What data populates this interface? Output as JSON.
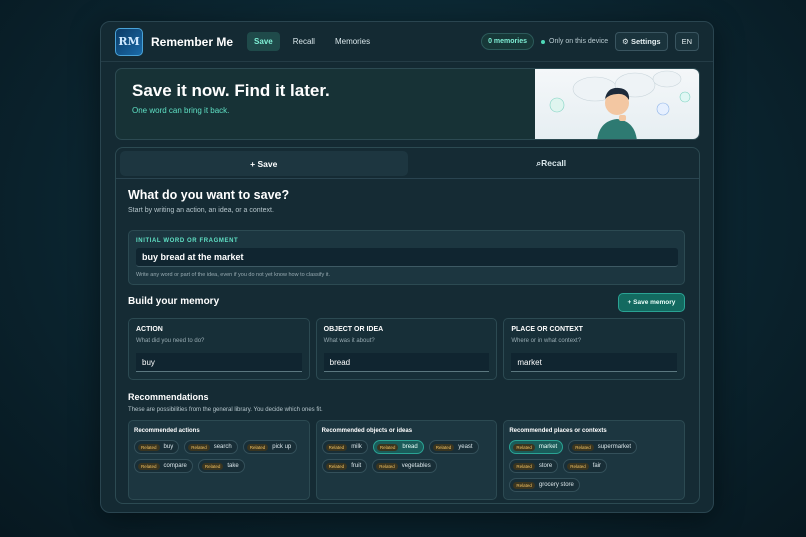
{
  "app": {
    "logo_text": "RM",
    "brand": "Remember Me",
    "nav": [
      "Save",
      "Recall",
      "Memories"
    ],
    "memories_count": "0 memories",
    "device_note": "Only on this device",
    "settings_label": "Settings",
    "lang": "EN"
  },
  "hero": {
    "title": "Save it now. Find it later.",
    "subtitle": "One word can bring it back."
  },
  "tabs": {
    "save": "+ Save",
    "recall": "⌕Recall"
  },
  "save": {
    "title": "What do you want to save?",
    "description": "Start by writing an action, an idea, or a context.",
    "initial_label": "INITIAL WORD OR FRAGMENT",
    "initial_value": "buy bread at the market",
    "initial_help": "Write any word or part of the idea, even if you do not yet know how to classify it."
  },
  "build": {
    "title": "Build your memory",
    "save_button": "+ Save memory",
    "fields": [
      {
        "title": "ACTION",
        "help": "What did you need to do?",
        "value": "buy"
      },
      {
        "title": "OBJECT OR IDEA",
        "help": "What was it about?",
        "value": "bread"
      },
      {
        "title": "PLACE OR CONTEXT",
        "help": "Where or in what context?",
        "value": "market"
      }
    ]
  },
  "recommendations": {
    "title": "Recommendations",
    "description": "These are possibilities from the general library. You decide which ones fit.",
    "tag": "Related",
    "groups": [
      {
        "title": "Recommended actions",
        "chips": [
          "buy",
          "search",
          "pick up",
          "compare",
          "take"
        ]
      },
      {
        "title": "Recommended objects or ideas",
        "chips": [
          "milk",
          "bread",
          "yeast",
          "fruit",
          "vegetables"
        ]
      },
      {
        "title": "Recommended places or contexts",
        "chips": [
          "market",
          "supermarket",
          "store",
          "fair",
          "grocery store"
        ]
      }
    ]
  },
  "colors": {
    "accent": "#5fe0c4",
    "primary": "#136a60",
    "tag": "#f0c060"
  }
}
